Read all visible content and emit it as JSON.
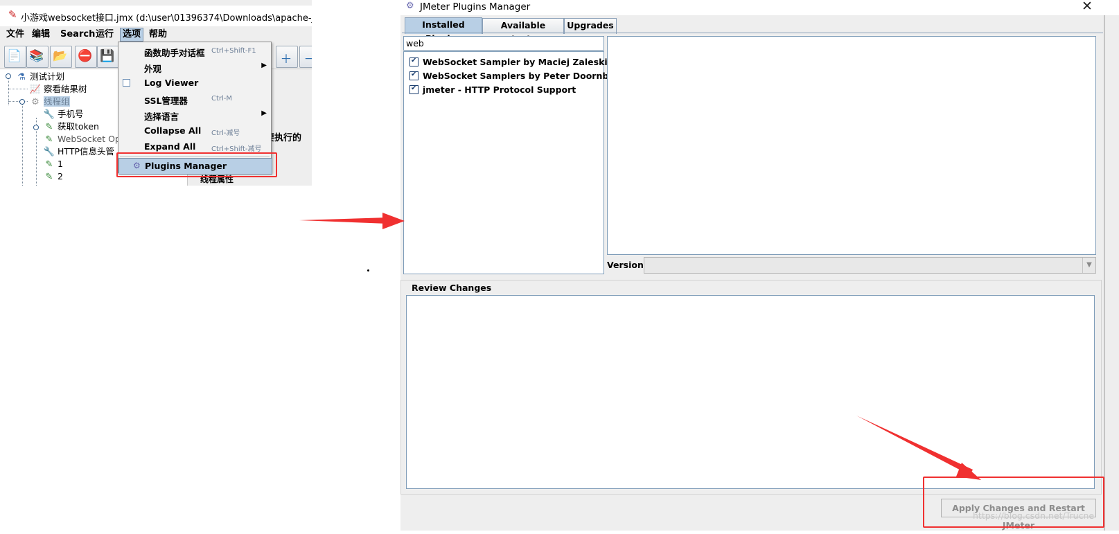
{
  "jmeter": {
    "title": "小游戏websocket接口.jmx (d:\\user\\01396374\\Downloads\\apache-jmeter-",
    "menu": [
      "文件",
      "编辑",
      "Search",
      "运行",
      "选项",
      "帮助"
    ],
    "active_menu": "选项",
    "toolbar_icons": [
      "new-icon",
      "templates-icon",
      "open-icon",
      "close-icon",
      "save-icon"
    ],
    "tree": [
      {
        "label": "测试计划",
        "icon": "flask-icon"
      },
      {
        "label": "察看结果树",
        "icon": "chart-icon"
      },
      {
        "label": "线程组",
        "icon": "gear-icon",
        "selected": true
      },
      {
        "label": "手机号",
        "icon": "wrench-icon"
      },
      {
        "label": "获取token",
        "icon": "pipette-icon"
      },
      {
        "label": "WebSocket Ope",
        "icon": "pipette-icon"
      },
      {
        "label": "HTTP信息头管",
        "icon": "wrench-icon"
      },
      {
        "label": "1",
        "icon": "pipette-icon"
      },
      {
        "label": "2",
        "icon": "pipette-icon"
      }
    ],
    "right_text": "要执行的",
    "thread_props": "线程属性"
  },
  "dropdown": {
    "items": [
      {
        "label": "函数助手对话框",
        "shortcut": "Ctrl+Shift-F1"
      },
      {
        "label": "外观",
        "submenu": true
      },
      {
        "label": "Log Viewer",
        "checkbox": true
      },
      {
        "label": "SSL管理器",
        "shortcut": "Ctrl-M"
      },
      {
        "label": "选择语言",
        "submenu": true
      },
      {
        "label": "Collapse All",
        "shortcut": "Ctrl-减号"
      },
      {
        "label": "Expand All",
        "shortcut": "Ctrl+Shift-减号"
      },
      {
        "label": "Plugins Manager",
        "highlighted": true
      }
    ]
  },
  "plugins_manager": {
    "title": "JMeter Plugins Manager",
    "tabs": [
      "Installed Plugins",
      "Available Plugins",
      "Upgrades"
    ],
    "active_tab": "Installed Plugins",
    "search_value": "web",
    "plugins": [
      {
        "label": "WebSocket Sampler by Maciej Zaleski",
        "checked": true
      },
      {
        "label": "WebSocket Samplers by Peter Doornbosch",
        "checked": true
      },
      {
        "label": "jmeter - HTTP Protocol Support",
        "checked": true
      }
    ],
    "version_label": "Version:",
    "review_label": "Review Changes",
    "apply_label": "Apply Changes and Restart JMeter"
  },
  "watermark": "https://blog.csdn.net/Trucne",
  "colors": {
    "highlight": "#b8cfe5",
    "annotation_red": "#f03030"
  }
}
